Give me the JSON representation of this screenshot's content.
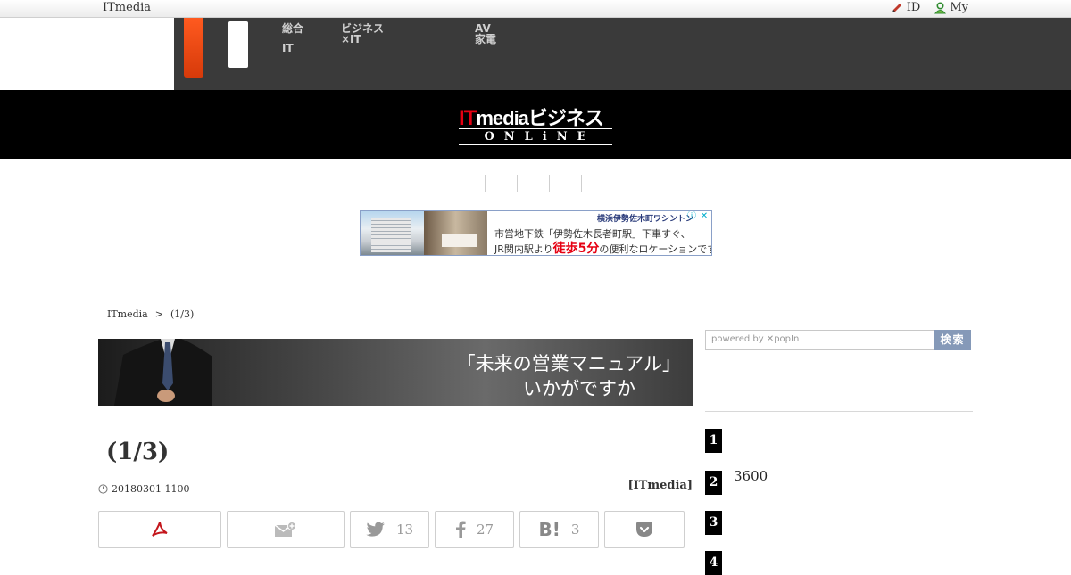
{
  "util_bar": {
    "brand": "ITmedia",
    "links": [
      {
        "label": "ID",
        "icon": "pencil-icon"
      },
      {
        "label": "My",
        "icon": "user-icon"
      }
    ]
  },
  "dark_nav": {
    "groups": [
      {
        "line1": "総合",
        "line2": "IT"
      },
      {
        "line1": "ビジネス",
        "line2": "×IT"
      },
      {
        "line1": "AV",
        "line2": "家電"
      }
    ]
  },
  "logo": {
    "it": "IT",
    "media": "media",
    "jp": "ビジネス",
    "online": "ONLiNE"
  },
  "ad": {
    "brand_line": "横浜伊勢佐木町ワシントン",
    "line1": "市営地下鉄「伊勢佐木長者町駅」下車すぐ、",
    "line2_pre": "JR関内駅より",
    "line2_em": "徒歩5分",
    "line2_post": "の便利なロケーションです。",
    "info_icon": "ⓘ",
    "close_icon": "✕"
  },
  "breadcrumb": {
    "home": "ITmedia",
    "sep": ">",
    "current": "(1/3)"
  },
  "hero": {
    "text1": "「未来の営業マニュアル」",
    "text2": "いかがですか"
  },
  "article": {
    "title": "(1/3)",
    "date": "20180301 1100",
    "source": "[ITmedia]"
  },
  "share": {
    "twitter_count": "13",
    "facebook_count": "27",
    "hatena_label": "B!",
    "hatena_count": "3"
  },
  "sidebar": {
    "search_placeholder": "powered by ✕popIn",
    "search_button": "検索",
    "ranking": [
      {
        "num": "1",
        "text": ""
      },
      {
        "num": "2",
        "text": "3600"
      },
      {
        "num": "3",
        "text": ""
      },
      {
        "num": "4",
        "text": ""
      }
    ]
  }
}
